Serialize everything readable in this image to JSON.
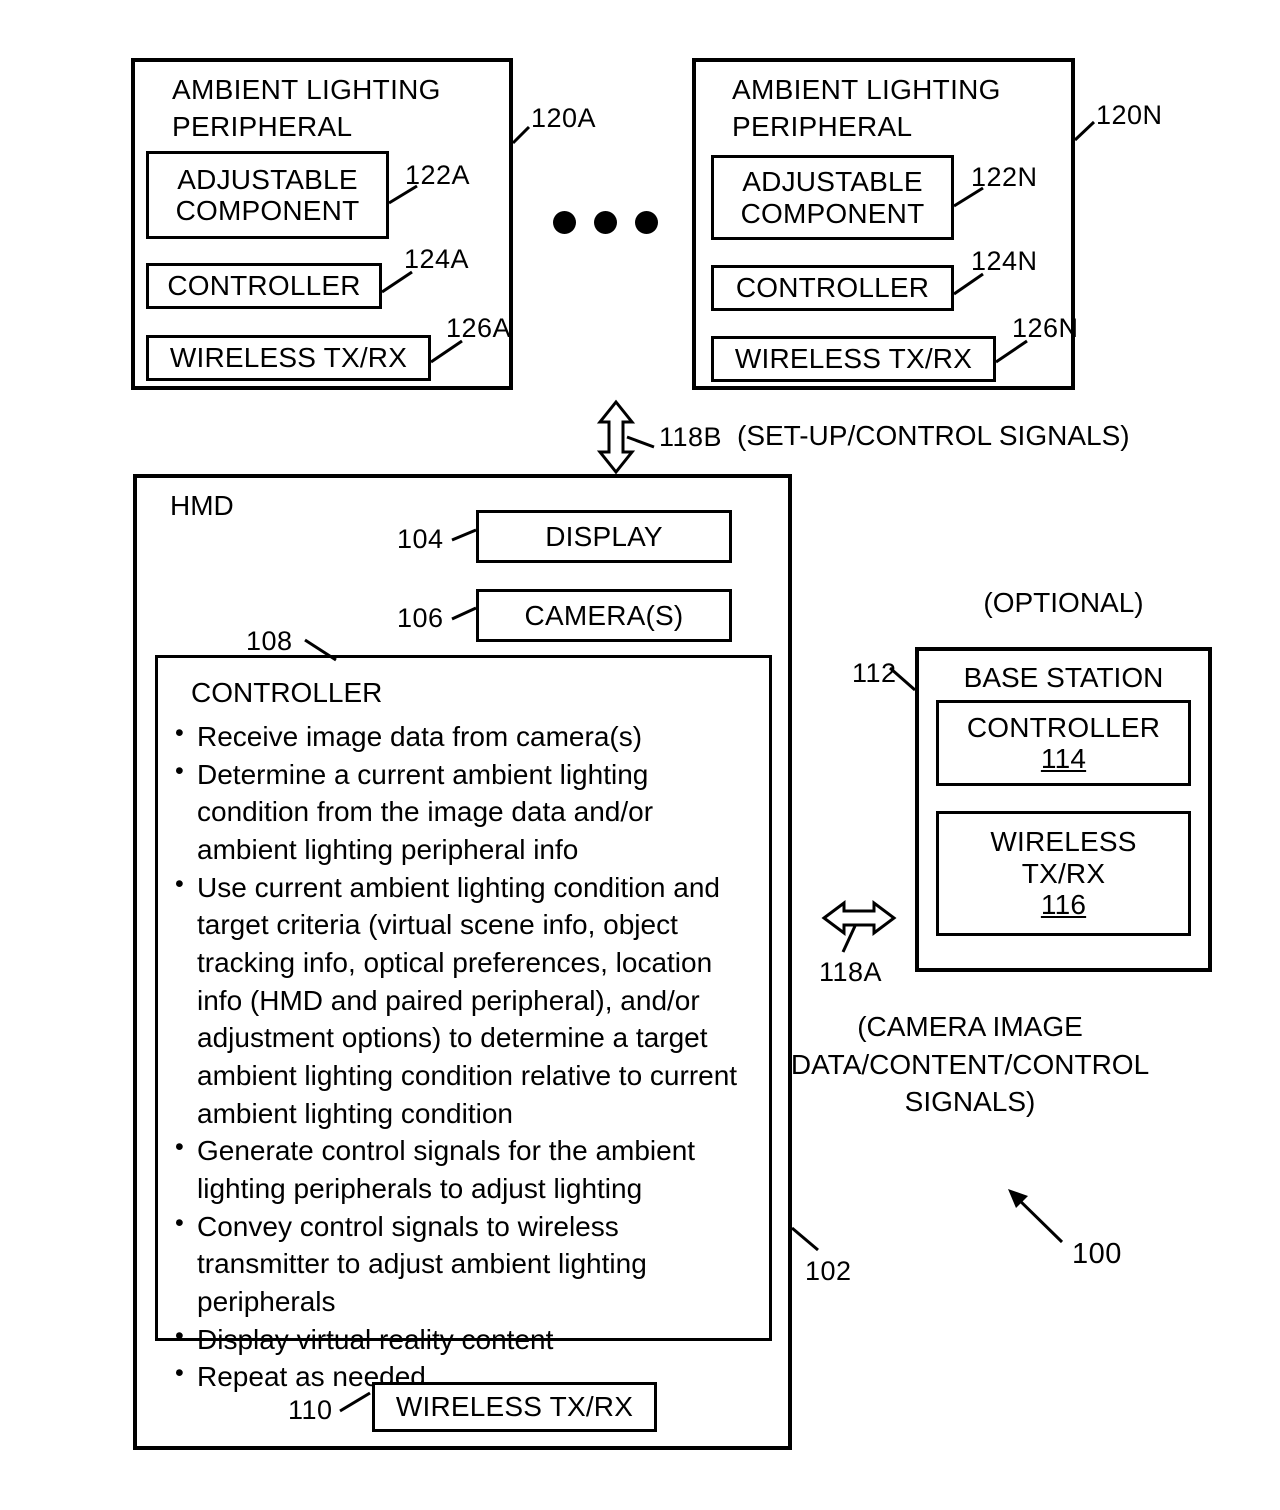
{
  "figure": {
    "reference_numeral": "100",
    "peripherals": [
      {
        "title": "AMBIENT LIGHTING\nPERIPHERAL",
        "ref": "120A",
        "components": [
          {
            "label": "ADJUSTABLE\nCOMPONENT",
            "ref": "122A"
          },
          {
            "label": "CONTROLLER",
            "ref": "124A"
          },
          {
            "label": "WIRELESS TX/RX",
            "ref": "126A"
          }
        ]
      },
      {
        "title": "AMBIENT LIGHTING\nPERIPHERAL",
        "ref": "120N",
        "components": [
          {
            "label": "ADJUSTABLE\nCOMPONENT",
            "ref": "122N"
          },
          {
            "label": "CONTROLLER",
            "ref": "124N"
          },
          {
            "label": "WIRELESS TX/RX",
            "ref": "126N"
          }
        ]
      }
    ],
    "ellipsis": "• • •",
    "link_118b": {
      "ref": "118B",
      "caption": "(SET-UP/CONTROL SIGNALS)"
    },
    "hmd": {
      "title": "HMD",
      "ref": "102",
      "display": {
        "label": "DISPLAY",
        "ref": "104"
      },
      "cameras": {
        "label": "CAMERA(S)",
        "ref": "106"
      },
      "controller": {
        "title": "CONTROLLER",
        "ref": "108",
        "bullets": [
          "Receive image data from camera(s)",
          "Determine a current ambient lighting condition from the image data and/or ambient lighting peripheral info",
          "Use current ambient lighting condition and target criteria (virtual scene info, object tracking info, optical preferences, location info (HMD and paired peripheral), and/or adjustment options) to determine a target ambient lighting condition relative to current ambient lighting condition",
          "Generate control signals for the ambient lighting peripherals to adjust lighting",
          "Convey control signals to wireless transmitter to adjust ambient lighting peripherals",
          "Display virtual reality content",
          "Repeat as needed"
        ]
      },
      "wireless": {
        "label": "WIRELESS TX/RX",
        "ref": "110"
      }
    },
    "base_station": {
      "optional_label": "(OPTIONAL)",
      "title": "BASE STATION",
      "ref": "112",
      "components": [
        {
          "label": "CONTROLLER",
          "ref": "114"
        },
        {
          "label": "WIRELESS\nTX/RX",
          "ref": "116"
        }
      ]
    },
    "link_118a": {
      "ref": "118A",
      "caption": "(CAMERA IMAGE\nDATA/CONTENT/CONTROL\nSIGNALS)"
    }
  }
}
